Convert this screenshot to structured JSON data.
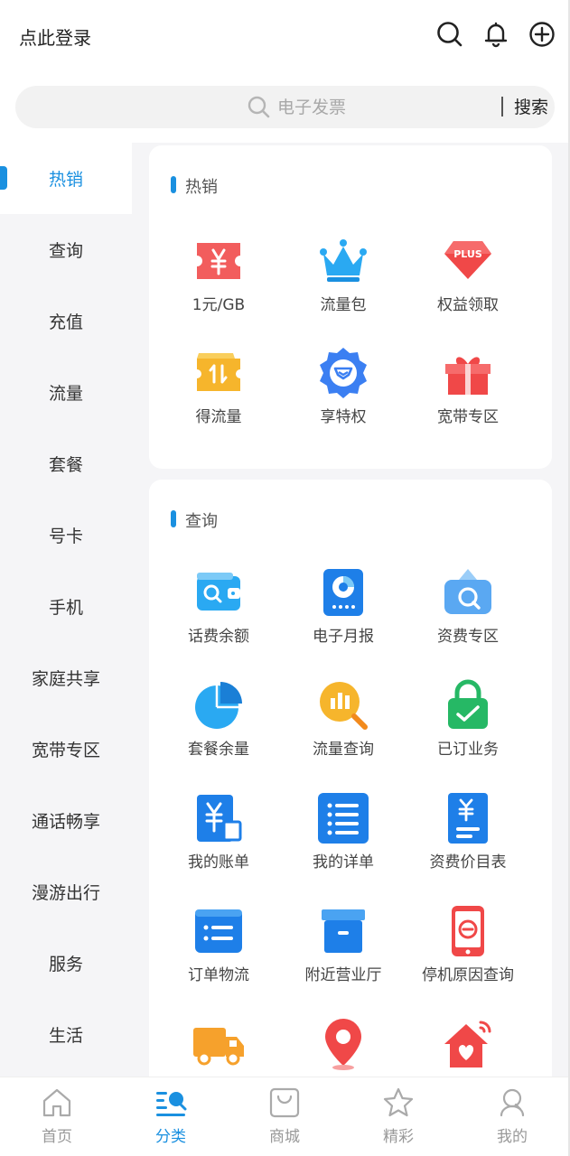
{
  "header": {
    "login_text": "点此登录",
    "icons": [
      "search-icon",
      "bell-icon",
      "add-circle-icon"
    ]
  },
  "search": {
    "placeholder": "电子发票",
    "button_label": "搜索"
  },
  "sidebar": {
    "items": [
      {
        "label": "热销",
        "active": true
      },
      {
        "label": "查询"
      },
      {
        "label": "充值"
      },
      {
        "label": "流量"
      },
      {
        "label": "套餐"
      },
      {
        "label": "号卡"
      },
      {
        "label": "手机"
      },
      {
        "label": "家庭共享"
      },
      {
        "label": "宽带专区"
      },
      {
        "label": "通话畅享"
      },
      {
        "label": "漫游出行"
      },
      {
        "label": "服务"
      },
      {
        "label": "生活"
      }
    ]
  },
  "sections": [
    {
      "title": "热销",
      "items": [
        {
          "label": "1元/GB",
          "icon": "yuan-ticket-icon"
        },
        {
          "label": "流量包",
          "icon": "crown-icon"
        },
        {
          "label": "权益领取",
          "icon": "plus-diamond-icon"
        },
        {
          "label": "得流量",
          "icon": "data-ticket-icon"
        },
        {
          "label": "享特权",
          "icon": "privilege-badge-icon"
        },
        {
          "label": "宽带专区",
          "icon": "gift-icon"
        }
      ]
    },
    {
      "title": "查询",
      "items": [
        {
          "label": "话费余额",
          "icon": "wallet-search-icon"
        },
        {
          "label": "电子月报",
          "icon": "pie-report-icon"
        },
        {
          "label": "资费专区",
          "icon": "folder-search-icon"
        },
        {
          "label": "套餐余量",
          "icon": "pie-chart-icon"
        },
        {
          "label": "流量查询",
          "icon": "bar-magnifier-icon"
        },
        {
          "label": "已订业务",
          "icon": "lock-check-icon"
        },
        {
          "label": "我的账单",
          "icon": "bill-icon"
        },
        {
          "label": "我的详单",
          "icon": "list-detail-icon"
        },
        {
          "label": "资费价目表",
          "icon": "price-list-icon"
        },
        {
          "label": "订单物流",
          "icon": "order-list-icon"
        },
        {
          "label": "附近营业厅",
          "icon": "storage-box-icon"
        },
        {
          "label": "停机原因查询",
          "icon": "phone-stop-icon"
        },
        {
          "label": "",
          "icon": "truck-icon"
        },
        {
          "label": "",
          "icon": "location-pin-icon"
        },
        {
          "label": "",
          "icon": "heart-home-icon"
        }
      ]
    }
  ],
  "tabbar": {
    "items": [
      {
        "label": "首页",
        "icon": "home-icon"
      },
      {
        "label": "分类",
        "icon": "category-icon",
        "active": true
      },
      {
        "label": "商城",
        "icon": "shopping-bag-icon"
      },
      {
        "label": "精彩",
        "icon": "star-icon"
      },
      {
        "label": "我的",
        "icon": "user-icon"
      }
    ]
  },
  "colors": {
    "accent": "#1a90e0",
    "sidebar_bg": "#f5f5f7",
    "search_bg": "#f2f2f2"
  }
}
